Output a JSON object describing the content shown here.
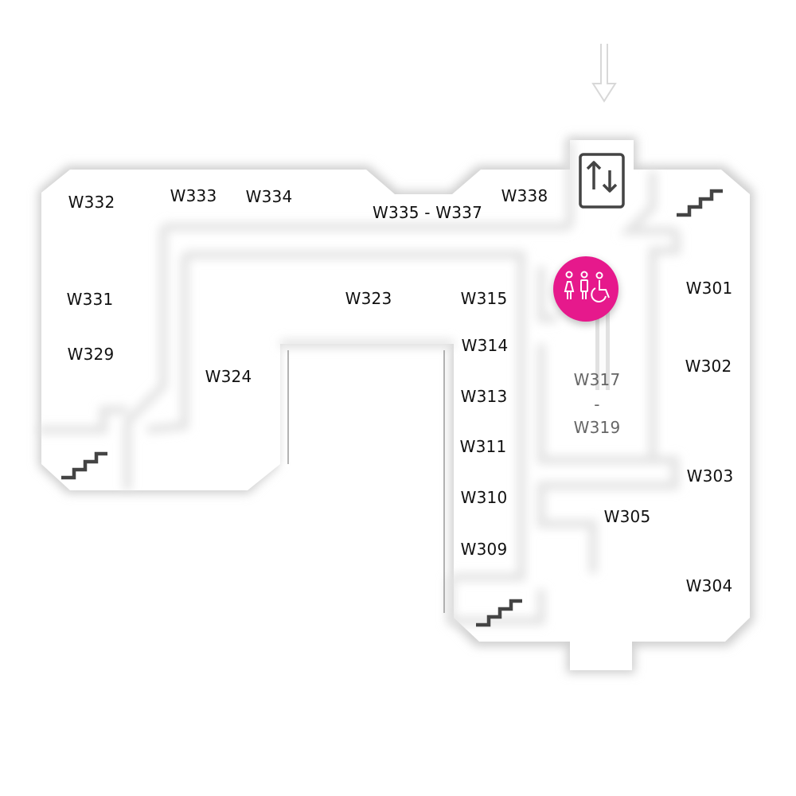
{
  "map": {
    "rooms": [
      {
        "id": "w332",
        "label": "W332"
      },
      {
        "id": "w333",
        "label": "W333"
      },
      {
        "id": "w334",
        "label": "W334"
      },
      {
        "id": "w335-337",
        "label": "W335 - W337"
      },
      {
        "id": "w338",
        "label": "W338"
      },
      {
        "id": "w331",
        "label": "W331"
      },
      {
        "id": "w329",
        "label": "W329"
      },
      {
        "id": "w324",
        "label": "W324"
      },
      {
        "id": "w323",
        "label": "W323"
      },
      {
        "id": "w315",
        "label": "W315"
      },
      {
        "id": "w314",
        "label": "W314"
      },
      {
        "id": "w313",
        "label": "W313"
      },
      {
        "id": "w311",
        "label": "W311"
      },
      {
        "id": "w310",
        "label": "W310"
      },
      {
        "id": "w309",
        "label": "W309"
      },
      {
        "id": "w301",
        "label": "W301"
      },
      {
        "id": "w302",
        "label": "W302"
      },
      {
        "id": "w303",
        "label": "W303"
      },
      {
        "id": "w305",
        "label": "W305"
      },
      {
        "id": "w304",
        "label": "W304"
      }
    ],
    "range_label": {
      "top": "W317",
      "separator": "-",
      "bottom": "W319"
    },
    "icons": {
      "entrance": "down-arrow-icon",
      "elevator": "elevator-icon",
      "stairs": "stairs-icon",
      "restroom": "restroom-icon"
    },
    "colors": {
      "accent": "#e6198c",
      "floor": "#ffffff",
      "shadow": "#d6d6d6",
      "icon": "#444444",
      "text": "#111111"
    }
  }
}
